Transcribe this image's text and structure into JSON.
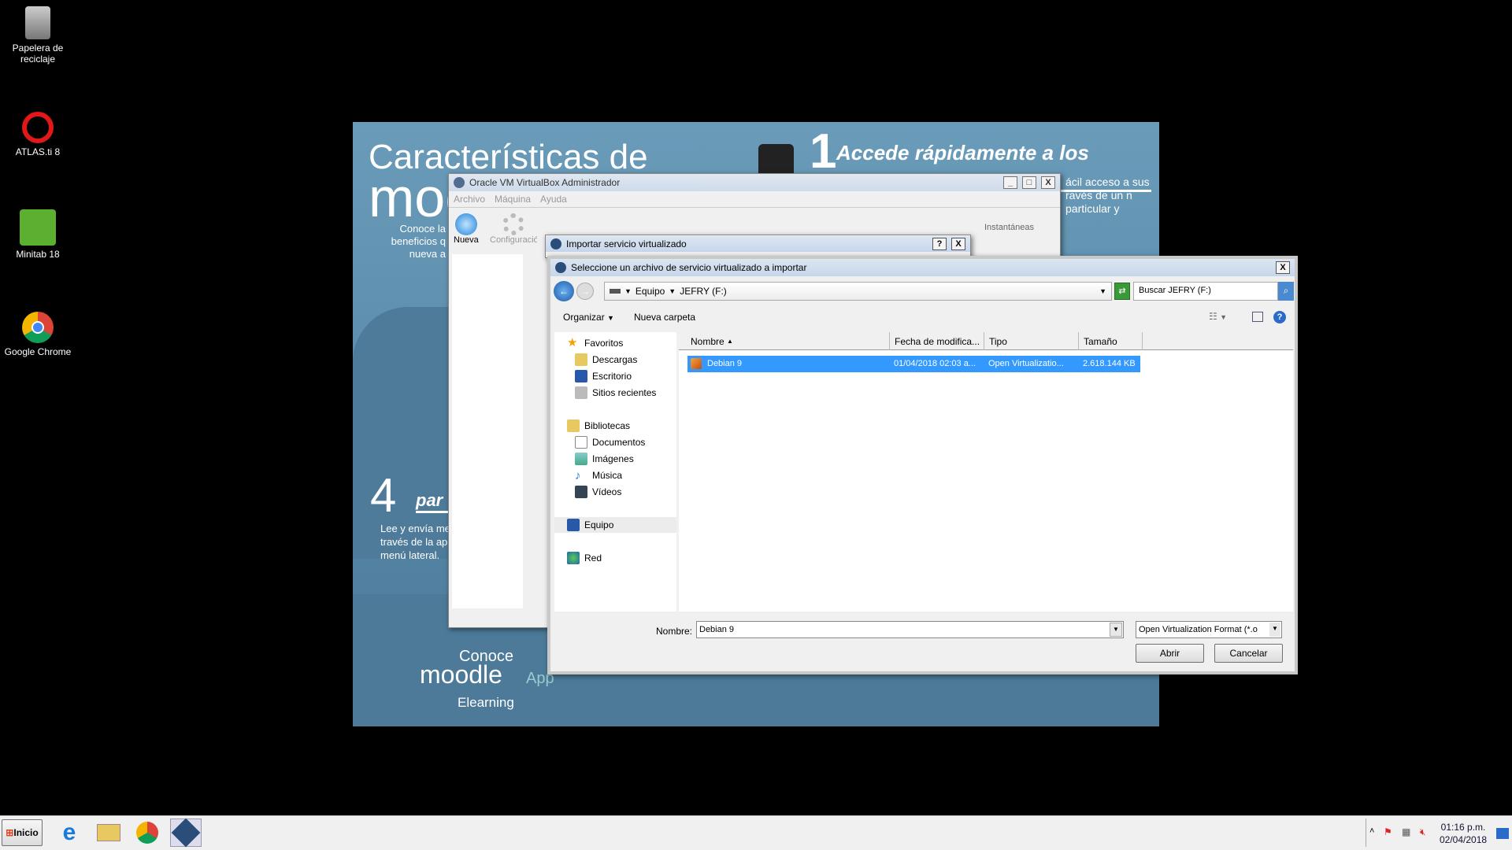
{
  "desktop": {
    "icons": [
      {
        "label": "Papelera de reciclaje"
      },
      {
        "label": "ATLAS.ti 8"
      },
      {
        "label": "Minitab 18"
      },
      {
        "label": "Google Chrome"
      }
    ]
  },
  "wallpaper": {
    "title1": "Características de",
    "title2": "moo",
    "subtitle": "Conoce la beneficios q nueva a",
    "heading1_num": "1",
    "heading1": "Accede rápidamente a los cursos",
    "text1": "ácil acceso a sus ravés de un n particular y",
    "heading4_num": "4",
    "heading4": "par",
    "text4": "Lee y envía me través de la ap menú lateral.",
    "footer_conoce": "Conoce",
    "footer_moodle": "moodle",
    "footer_app": "App",
    "footer_brand": "Elearning"
  },
  "vbox": {
    "title": "Oracle VM VirtualBox Administrador",
    "menu": [
      "Archivo",
      "Máquina",
      "Ayuda"
    ],
    "tools": [
      "Nueva",
      "Configuració"
    ],
    "snapshots": "Instantáneas"
  },
  "import_dialog": {
    "title": "Importar servicio virtualizado",
    "help": "?",
    "close": "X"
  },
  "file_dialog": {
    "title": "Seleccione un archivo de servicio virtualizado a importar",
    "close": "X",
    "breadcrumb": [
      "Equipo",
      "JEFRY (F:)"
    ],
    "search_placeholder": "Buscar JEFRY (F:)",
    "toolbar": {
      "organize": "Organizar",
      "new_folder": "Nueva carpeta"
    },
    "nav": {
      "favorites": "Favoritos",
      "fav_items": [
        "Descargas",
        "Escritorio",
        "Sitios recientes"
      ],
      "libraries": "Bibliotecas",
      "lib_items": [
        "Documentos",
        "Imágenes",
        "Música",
        "Vídeos"
      ],
      "computer": "Equipo",
      "network": "Red"
    },
    "columns": [
      "Nombre",
      "Fecha de modifica...",
      "Tipo",
      "Tamaño"
    ],
    "rows": [
      {
        "name": "Debian 9",
        "date": "01/04/2018 02:03 a...",
        "type": "Open Virtualizatio...",
        "size": "2.618.144 KB",
        "selected": true
      }
    ],
    "filename_label": "Nombre:",
    "filename_value": "Debian 9",
    "filter": "Open Virtualization Format (*.o",
    "open": "Abrir",
    "cancel": "Cancelar"
  },
  "taskbar": {
    "start": "Inicio",
    "time": "01:16 p.m.",
    "date": "02/04/2018"
  },
  "colors": {
    "selection": "#3399ff",
    "wallpaper": "#5a8aab"
  }
}
